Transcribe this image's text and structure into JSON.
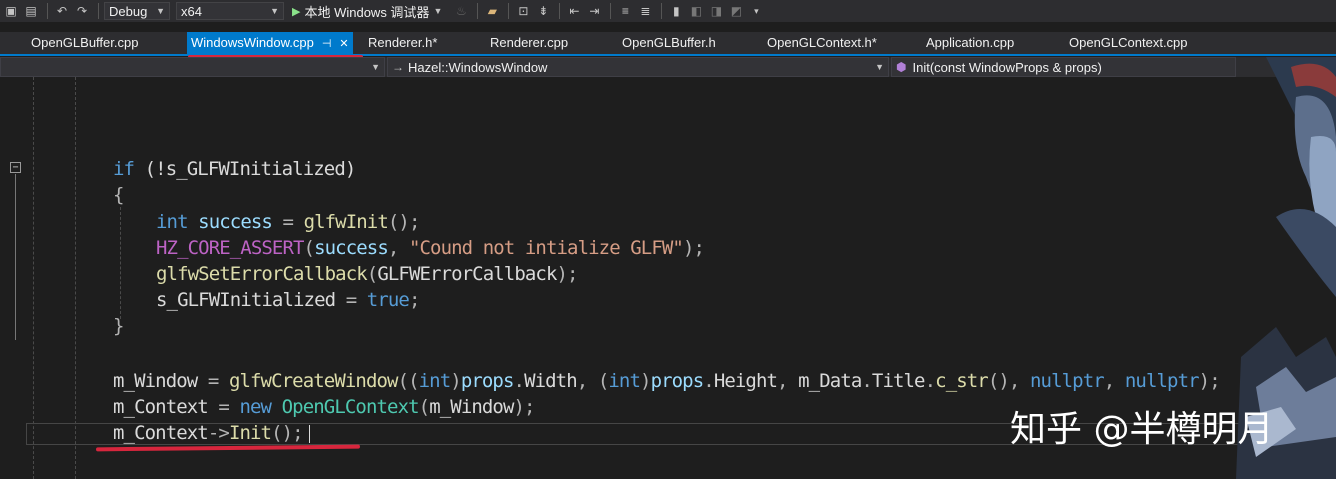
{
  "toolbar": {
    "config": "Debug",
    "platform": "x64",
    "run_label": "本地 Windows 调试器"
  },
  "tabs": [
    {
      "label": "OpenGLBuffer.cpp",
      "active": false
    },
    {
      "label": "WindowsWindow.cpp",
      "active": true
    },
    {
      "label": "Renderer.h*",
      "active": false
    },
    {
      "label": "Renderer.cpp",
      "active": false
    },
    {
      "label": "OpenGLBuffer.h",
      "active": false
    },
    {
      "label": "OpenGLContext.h*",
      "active": false
    },
    {
      "label": "Application.cpp",
      "active": false
    },
    {
      "label": "OpenGLContext.cpp",
      "active": false
    }
  ],
  "navbar": {
    "scope": "Hazel::WindowsWindow",
    "member": "Init(const WindowProps & props)"
  },
  "icons": {
    "pin": "pin-icon",
    "close": "close-icon",
    "play": "play-icon",
    "collapse": "collapse-icon"
  },
  "code": {
    "l1_kw": "if",
    "l1_rest": " (!s_GLFWInitialized)",
    "l2": "{",
    "l3_kw": "int",
    "l3_var": " success",
    "l3_eq": " = ",
    "l3_fn": "glfwInit",
    "l3_end": "();",
    "l4_mac": "HZ_CORE_ASSERT",
    "l4_open": "(",
    "l4_var": "success",
    "l4_comma": ", ",
    "l4_str": "\"Cound not intialize GLFW\"",
    "l4_end": ");",
    "l5_fn": "glfwSetErrorCallback",
    "l5_open": "(",
    "l5_arg": "GLFWErrorCallback",
    "l5_end": ");",
    "l6_var": "s_GLFWInitialized",
    "l6_eq": " = ",
    "l6_kw": "true",
    "l6_end": ";",
    "l7": "}",
    "l8_var": "m_Window",
    "l8_eq": " = ",
    "l8_fn": "glfwCreateWindow",
    "l8_a": "((",
    "l8_k1": "int",
    "l8_b": ")",
    "l8_p1": "props",
    "l8_d1": ".",
    "l8_m1": "Width",
    "l8_c": ", (",
    "l8_k2": "int",
    "l8_e": ")",
    "l8_p2": "props",
    "l8_d2": ".",
    "l8_m2": "Height",
    "l8_f": ", ",
    "l8_m3": "m_Data",
    "l8_d3": ".",
    "l8_m4": "Title",
    "l8_d4": ".",
    "l8_fn2": "c_str",
    "l8_g": "(), ",
    "l8_k3": "nullptr",
    "l8_h": ", ",
    "l8_k4": "nullptr",
    "l8_end": ");",
    "l9_var": "m_Context",
    "l9_eq": " = ",
    "l9_kw": "new",
    "l9_cls": " OpenGLContext",
    "l9_open": "(",
    "l9_arg": "m_Window",
    "l9_end": ");",
    "l10_var": "m_Context",
    "l10_arrow": "->",
    "l10_fn": "Init",
    "l10_end": "();"
  },
  "watermark": "知乎 @半樽明月",
  "colors": {
    "accent": "#007acc",
    "annotation": "#d7263d",
    "keyword": "#569cd6",
    "function": "#dcdcaa",
    "macro": "#bd63c5",
    "string": "#d69d85",
    "type": "#4ec9b0"
  }
}
